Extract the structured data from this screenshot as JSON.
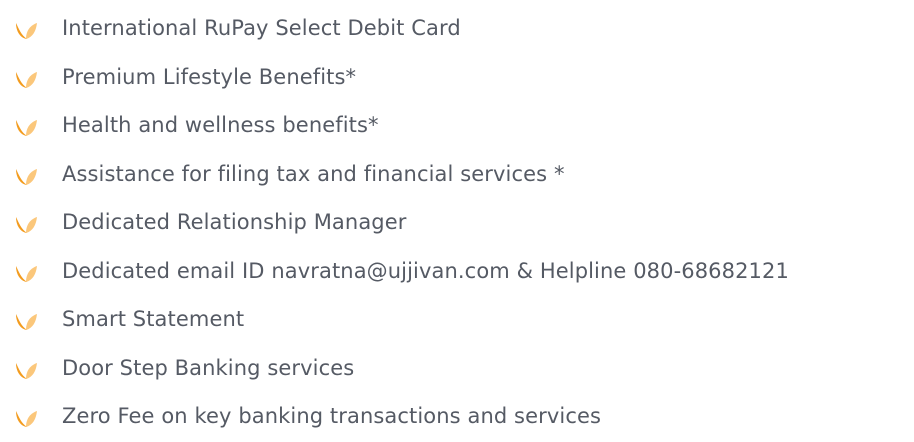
{
  "icon": {
    "name": "flame-leaf-icon",
    "colors": {
      "dark": "#f39c1f",
      "light": "#fbc77b"
    }
  },
  "text_color": "#555a64",
  "benefits": [
    {
      "label": "International RuPay Select Debit Card"
    },
    {
      "label": "Premium Lifestyle Benefits*"
    },
    {
      "label": "Health and wellness benefits*"
    },
    {
      "label": "Assistance for filing tax and financial services *"
    },
    {
      "label": "Dedicated Relationship Manager"
    },
    {
      "label": "Dedicated email ID navratna@ujjivan.com & Helpline 080-68682121"
    },
    {
      "label": "Smart Statement"
    },
    {
      "label": "Door Step Banking services"
    },
    {
      "label": "Zero Fee on key banking transactions and services"
    }
  ]
}
